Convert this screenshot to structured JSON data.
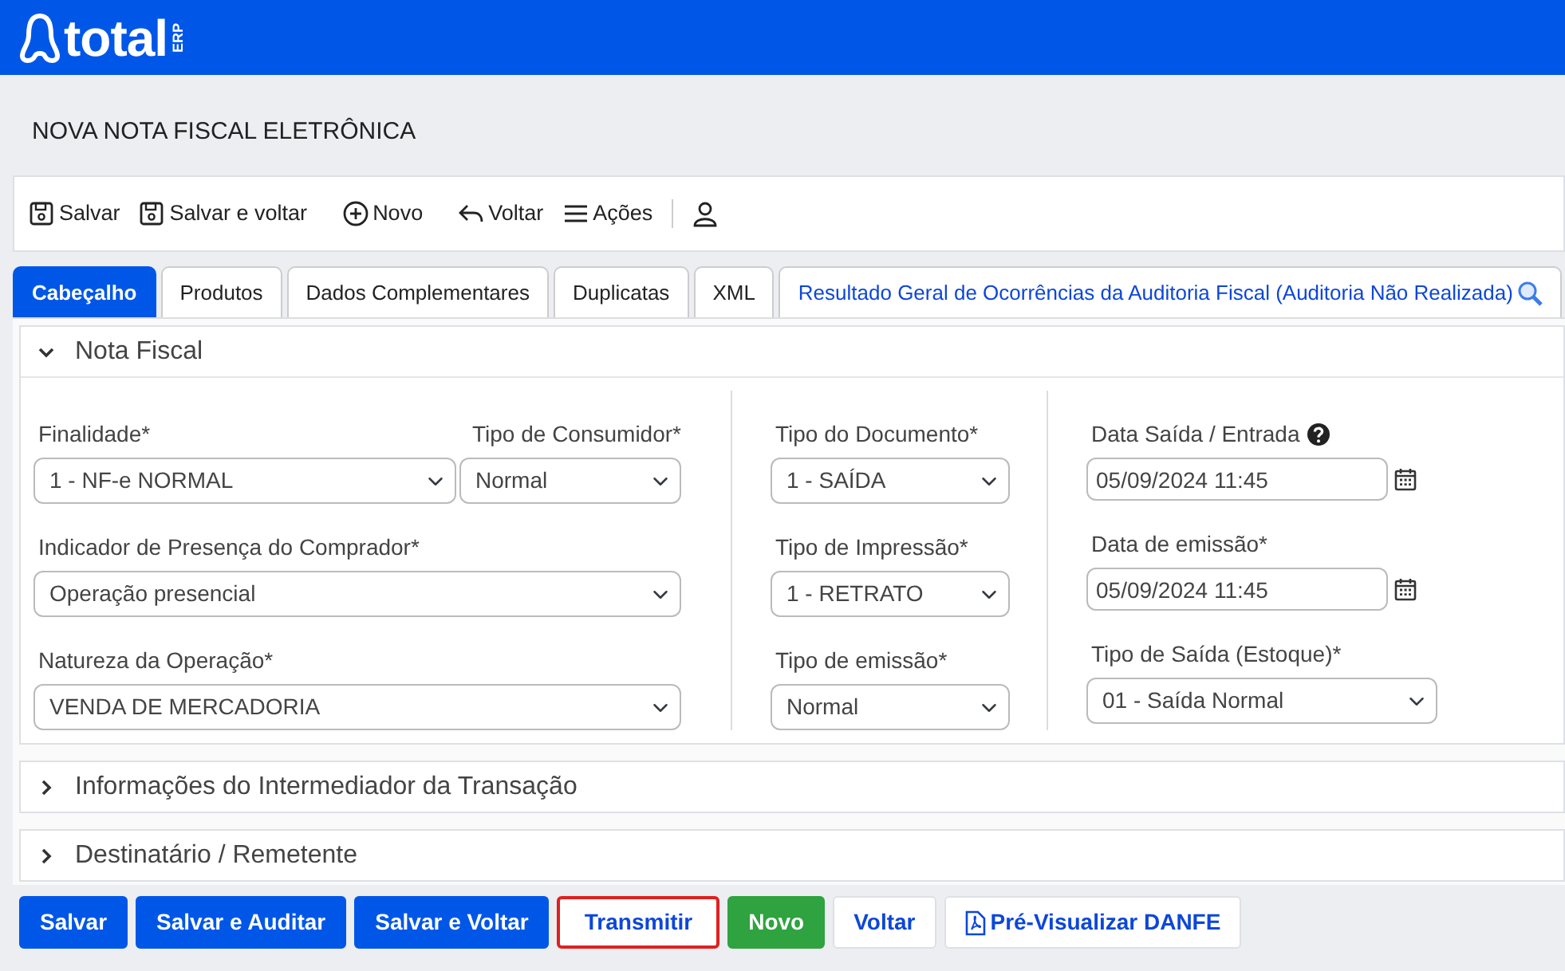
{
  "brand": {
    "name": "total",
    "suffix": "ERP"
  },
  "page_title": "NOVA NOTA FISCAL ELETRÔNICA",
  "toolbar": [
    {
      "label": "Salvar",
      "kind": "save"
    },
    {
      "label": "Salvar e voltar",
      "kind": "save"
    },
    {
      "label": "Novo",
      "kind": "new"
    },
    {
      "label": "Voltar",
      "kind": "back"
    },
    {
      "label": "Ações",
      "kind": "menu"
    },
    {
      "kind": "user"
    }
  ],
  "tabs": [
    {
      "label": "Cabeçalho",
      "selected": true,
      "kind": "plain"
    },
    {
      "label": "Produtos",
      "selected": false,
      "kind": "plain"
    },
    {
      "label": "Dados Complementares",
      "selected": false,
      "kind": "plain"
    },
    {
      "label": "Duplicatas",
      "selected": false,
      "kind": "plain"
    },
    {
      "label": "XML",
      "selected": false,
      "kind": "plain"
    },
    {
      "label": "Resultado Geral de Ocorrências da Auditoria Fiscal (Auditoria Não Realizada)",
      "selected": false,
      "kind": "audit"
    }
  ],
  "sections": [
    {
      "title": "Nota Fiscal",
      "expanded": true,
      "columns": [
        [
          [
            {
              "label": "Finalidade*",
              "value": "1 - NF-e NORMAL",
              "kind": "select",
              "help": false
            },
            {
              "label": "Tipo de Consumidor*",
              "value": "Normal",
              "kind": "select",
              "help": false
            }
          ],
          [
            {
              "label": "Indicador de Presença do Comprador*",
              "value": "Operação presencial",
              "kind": "select",
              "help": false
            }
          ],
          [
            {
              "label": "Natureza da Operação*",
              "value": "VENDA DE MERCADORIA",
              "kind": "select",
              "help": false
            }
          ]
        ],
        [
          [
            {
              "label": "Tipo do Documento*",
              "value": "1 - SAÍDA",
              "kind": "select",
              "help": false
            }
          ],
          [
            {
              "label": "Tipo de Impressão*",
              "value": "1 - RETRATO",
              "kind": "select",
              "help": false
            }
          ],
          [
            {
              "label": "Tipo de emissão*",
              "value": "Normal",
              "kind": "select",
              "help": false
            }
          ]
        ],
        [
          [
            {
              "label": "Data Saída / Entrada",
              "value": "05/09/2024 11:45",
              "kind": "date",
              "help": true
            }
          ],
          [
            {
              "label": "Data de emissão*",
              "value": "05/09/2024 11:45",
              "kind": "date",
              "help": false
            }
          ],
          [
            {
              "label": "Tipo de Saída (Estoque)*",
              "value": "01 - Saída Normal",
              "kind": "select",
              "help": false
            }
          ]
        ]
      ]
    },
    {
      "title": "Informações do Intermediador da Transação",
      "expanded": false
    },
    {
      "title": "Destinatário / Remetente",
      "expanded": false
    }
  ],
  "buttons": [
    {
      "label": "Salvar",
      "kind": "primary",
      "highlighted": false
    },
    {
      "label": "Salvar e Auditar",
      "kind": "primary",
      "highlighted": false
    },
    {
      "label": "Salvar e Voltar",
      "kind": "primary",
      "highlighted": false
    },
    {
      "label": "Transmitir",
      "kind": "outline",
      "highlighted": true
    },
    {
      "label": "Novo",
      "kind": "success",
      "highlighted": false
    },
    {
      "label": "Voltar",
      "kind": "outline",
      "highlighted": false
    },
    {
      "label": "Pré-Visualizar DANFE",
      "kind": "pdf",
      "highlighted": false
    }
  ]
}
